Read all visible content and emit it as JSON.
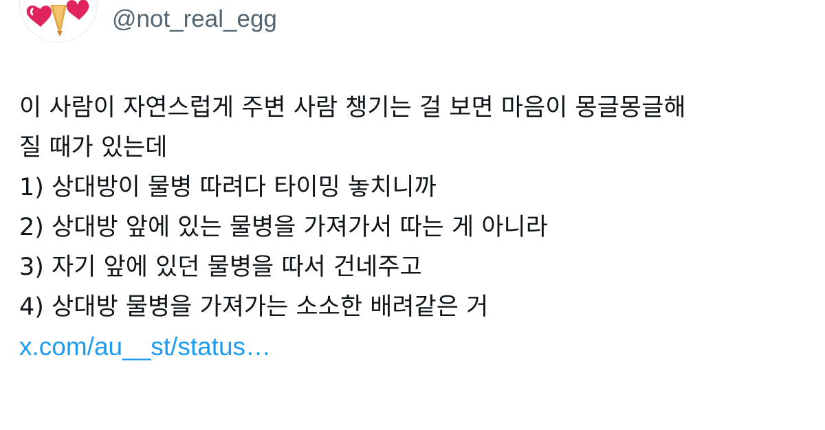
{
  "author": {
    "handle": "@not_real_egg",
    "avatar_icon": "heart-cone-avatar"
  },
  "tweet": {
    "lines": [
      "이 사람이 자연스럽게 주변 사람 챙기는 걸 보면 마음이 몽글몽글해",
      "질 때가 있는데",
      "1) 상대방이 물병 따려다 타이밍 놓치니까",
      "2) 상대방 앞에 있는 물병을 가져가서 따는 게 아니라",
      "3) 자기 앞에 있던 물병을 따서 건네주고",
      "4) 상대방 물병을 가져가는 소소한 배려같은 거"
    ],
    "link_text": "x.com/au__st/status…"
  },
  "colors": {
    "text": "#0f1419",
    "secondary": "#536471",
    "link": "#1d9bf0"
  }
}
